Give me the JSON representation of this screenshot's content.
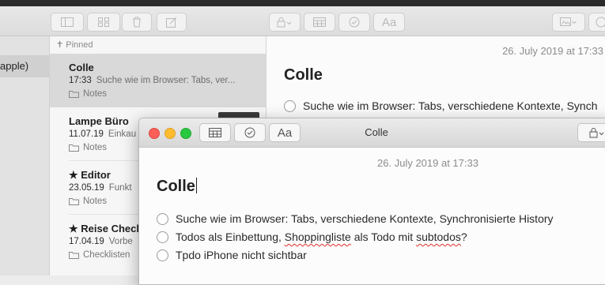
{
  "sidebar": {
    "selected_label": "apple)"
  },
  "list": {
    "pinned_label": "Pinned",
    "notes": [
      {
        "title": "Colle",
        "date": "17:33",
        "snippet": "Suche wie im Browser: Tabs, ver...",
        "folder": "Notes",
        "starred": false
      },
      {
        "title": "Lampe Büro",
        "date": "11.07.19",
        "snippet": "Einkau",
        "folder": "Notes",
        "starred": false
      },
      {
        "title": "★ Editor",
        "date": "23.05.19",
        "snippet": "Funkt",
        "folder": "Notes",
        "starred": true
      },
      {
        "title": "★ Reise Check",
        "date": "17.04.19",
        "snippet": "Vorbe",
        "folder": "Checklisten",
        "starred": true
      }
    ]
  },
  "editor": {
    "date": "26. July 2019 at 17:33",
    "title": "Colle",
    "first_item": "Suche wie im Browser: Tabs, verschiedene Kontexte, Synch"
  },
  "window": {
    "title": "Colle",
    "format_button_label": "Aa",
    "date": "26. July 2019 at 17:33",
    "note_title": "Colle",
    "items": [
      {
        "parts": [
          "Suche wie im Browser: Tabs, verschiedene Kontexte, Synchronisierte History"
        ]
      },
      {
        "parts": [
          "Todos als Einbettung, ",
          "Shoppingliste",
          " als Todo mit ",
          "subtodos",
          "?"
        ]
      },
      {
        "parts": [
          "Tpdo iPhone nicht sichtbar"
        ]
      }
    ]
  },
  "toolbar": {
    "format_button_label": "Aa"
  },
  "icons": [
    "sidebar-toggle-icon",
    "gallery-view-icon",
    "trash-icon",
    "compose-icon",
    "lock-icon",
    "table-icon",
    "checklist-icon",
    "photo-icon",
    "share-icon",
    "folder-icon"
  ]
}
